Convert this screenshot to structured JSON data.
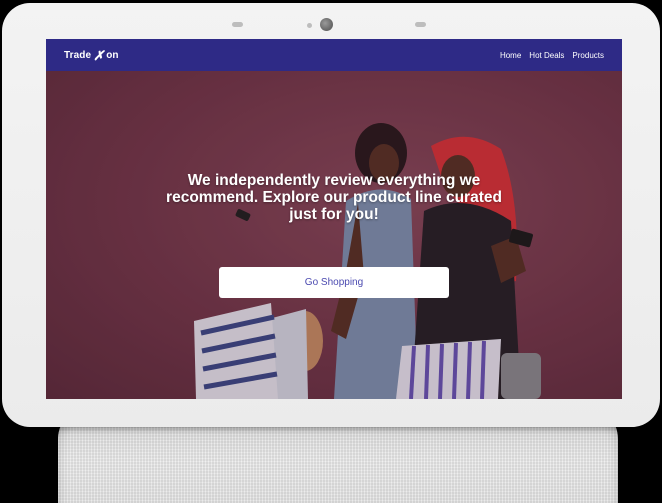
{
  "navbar": {
    "logo": {
      "text_left": "Trade",
      "mark": "✗",
      "text_right": "on"
    },
    "links": [
      "Home",
      "Hot Deals",
      "Products"
    ]
  },
  "hero": {
    "heading": "We independently review everything we recommend. Explore our product line curated just for you!",
    "cta_label": "Go Shopping"
  },
  "colors": {
    "navbar_bg": "#2e2a86",
    "hero_bg": "#74384b",
    "cta_text": "#4b4ab0",
    "device_frame": "#ebebeb"
  }
}
